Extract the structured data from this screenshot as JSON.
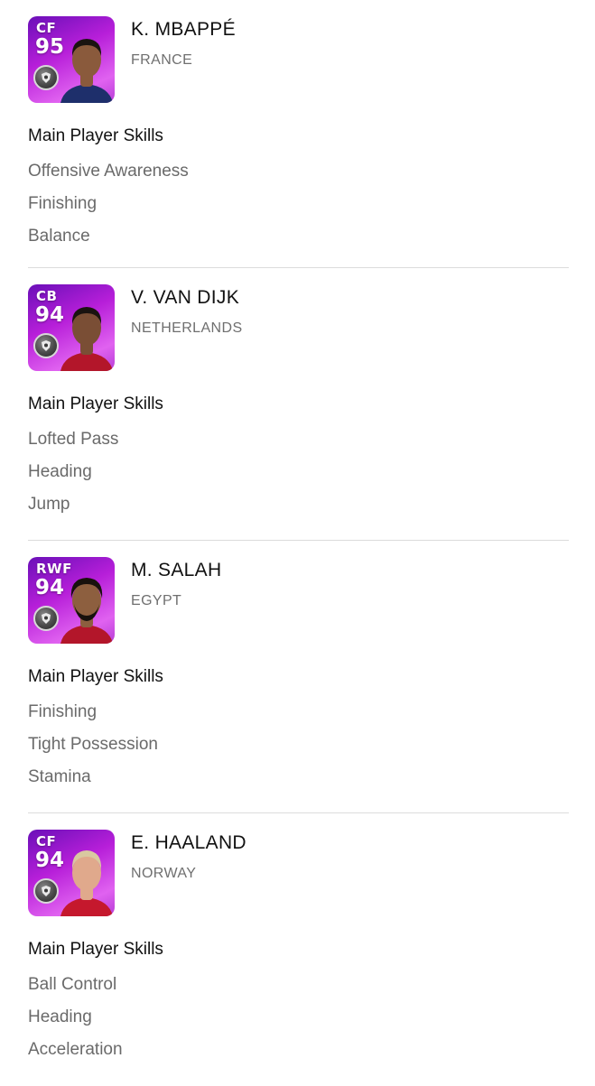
{
  "skills_heading": "Main Player Skills",
  "players": [
    {
      "position": "CF",
      "rating": "95",
      "name": "K. MBAPPÉ",
      "country": "FRANCE",
      "skills": [
        "Offensive Awareness",
        "Finishing",
        "Balance"
      ],
      "shirt_color": "#1e2f6b",
      "skin_color": "#8a5a3c",
      "hair_color": "#1a1310"
    },
    {
      "position": "CB",
      "rating": "94",
      "name": "V. VAN DIJK",
      "country": "NETHERLANDS",
      "skills": [
        "Lofted Pass",
        "Heading",
        "Jump"
      ],
      "shirt_color": "#b3162a",
      "skin_color": "#7a4e35",
      "hair_color": "#1a1310"
    },
    {
      "position": "RWF",
      "rating": "94",
      "name": "M. SALAH",
      "country": "EGYPT",
      "skills": [
        "Finishing",
        "Tight Possession",
        "Stamina"
      ],
      "shirt_color": "#b3162a",
      "skin_color": "#8d5f3f",
      "hair_color": "#18110d"
    },
    {
      "position": "CF",
      "rating": "94",
      "name": "E. HAALAND",
      "country": "NORWAY",
      "skills": [
        "Ball Control",
        "Heading",
        "Acceleration"
      ],
      "shirt_color": "#c5182d",
      "skin_color": "#e0a98c",
      "hair_color": "#d9c8a0"
    }
  ]
}
